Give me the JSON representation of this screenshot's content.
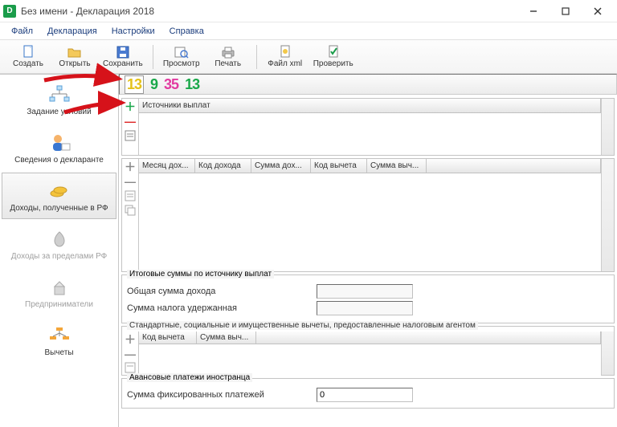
{
  "window": {
    "title": "Без имени - Декларация 2018"
  },
  "menu": {
    "file": "Файл",
    "declaration": "Декларация",
    "settings": "Настройки",
    "help": "Справка"
  },
  "toolbar": {
    "create": "Создать",
    "open": "Открыть",
    "save": "Сохранить",
    "preview": "Просмотр",
    "print": "Печать",
    "filexml": "Файл xml",
    "check": "Проверить"
  },
  "sidenav": {
    "conditions": "Задание условий",
    "declarant": "Сведения о декларанте",
    "income_rf": "Доходы, полученные в РФ",
    "income_abroad": "Доходы за пределами РФ",
    "entrepreneurs": "Предприниматели",
    "deductions": "Вычеты"
  },
  "rates": {
    "r13a": "13",
    "r9": "9",
    "r35": "35",
    "r13b": "13"
  },
  "panes": {
    "sources": {
      "title": "Источники выплат"
    },
    "income_grid": {
      "month": "Месяц дох...",
      "income_code": "Код дохода",
      "income_sum": "Сумма дох...",
      "deduct_code": "Код вычета",
      "deduct_sum": "Сумма выч..."
    },
    "totals": {
      "title": "Итоговые суммы по источнику выплат",
      "total_income": "Общая сумма дохода",
      "tax_withheld": "Сумма налога удержанная"
    },
    "agent_deductions": {
      "title": "Стандартные, социальные и имущественные вычеты, предоставленные налоговым агентом",
      "deduct_code": "Код вычета",
      "deduct_sum": "Сумма выч..."
    },
    "foreigner": {
      "title": "Авансовые платежи иностранца",
      "fixed_sum": "Сумма фиксированных платежей",
      "value": "0"
    }
  }
}
